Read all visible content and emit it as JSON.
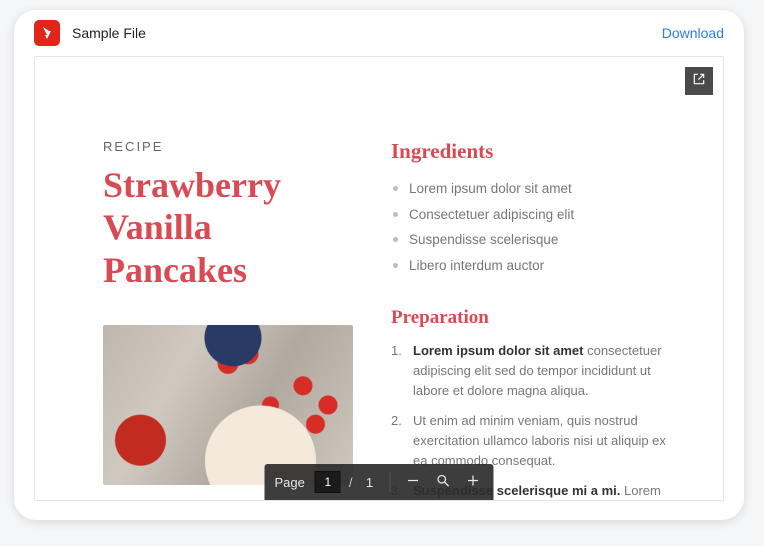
{
  "header": {
    "file_title": "Sample File",
    "download_label": "Download"
  },
  "document": {
    "eyebrow": "RECIPE",
    "title": "Strawberry Vanilla Pancakes",
    "ingredients_heading": "Ingredients",
    "ingredients": [
      "Lorem ipsum dolor sit amet",
      "Consectetuer adipiscing elit",
      "Suspendisse scelerisque",
      "Libero interdum auctor"
    ],
    "preparation_heading": "Preparation",
    "steps": [
      {
        "lead": "Lorem ipsum dolor sit amet",
        "rest": " consectetuer adipiscing elit sed do tempor incididunt ut labore et dolore magna aliqua."
      },
      {
        "lead": "",
        "rest": "Ut enim ad minim veniam, quis nostrud exercitation ullamco laboris nisi ut aliquip ex ea commodo consequat."
      },
      {
        "lead": "Suspendisse scelerisque mi a mi.",
        "rest": " Lorem ipsum dolor sit amet, consectetur"
      }
    ]
  },
  "toolbar": {
    "page_label": "Page",
    "current_page": "1",
    "total_pages": "1"
  }
}
